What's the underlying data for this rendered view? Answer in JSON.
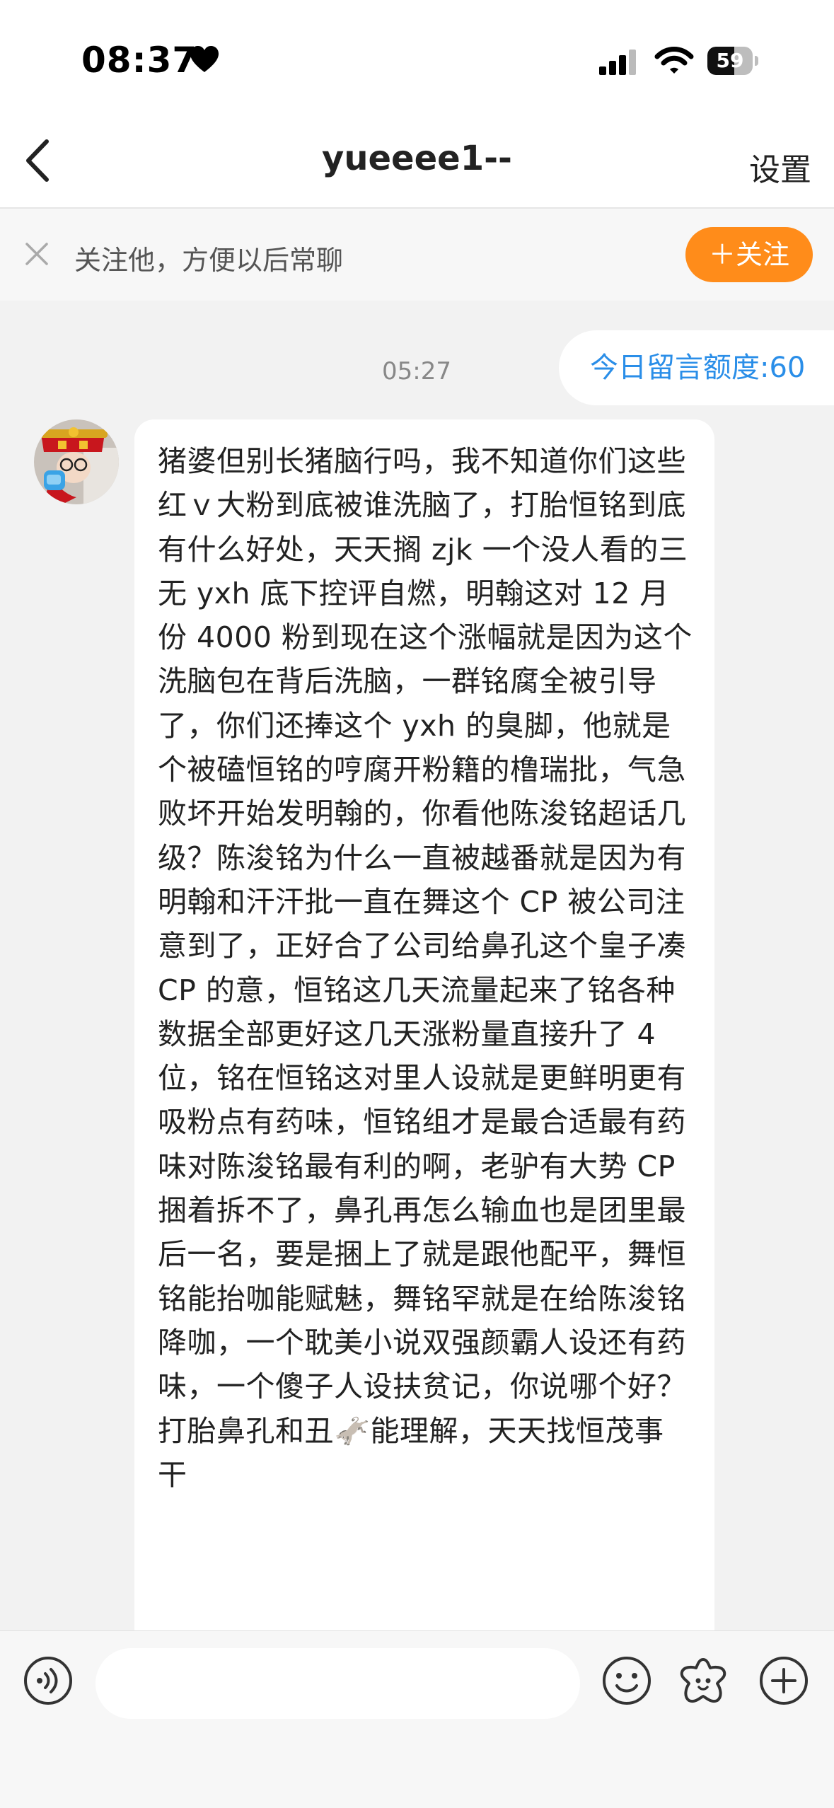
{
  "status_bar": {
    "time": "08:37",
    "battery_level": "59",
    "battery_fraction": 0.59,
    "icons": [
      "heart-icon",
      "cellular-signal-icon",
      "wifi-icon",
      "battery-icon"
    ]
  },
  "nav": {
    "title": "yueeee1--",
    "settings_label": "设置",
    "back_icon": "chevron-left-icon"
  },
  "follow_prompt": {
    "text": "关注他，方便以后常聊",
    "button_label": "＋关注",
    "close_icon": "close-icon",
    "button_color": "#ff8c1a"
  },
  "chat": {
    "timestamp": "05:27",
    "quota_text": "今日留言额度:60",
    "quota_color": "#2a8ee8",
    "message": {
      "text": "猪婆但别长猪脑行吗，我不知道你们这些红ｖ大粉到底被谁洗脑了，打胎恒铭到底有什么好处，天天搁 zjk 一个没人看的三无 yxh 底下控评自燃，明翰这对 12 月份 4000 粉到现在这个涨幅就是因为这个洗脑包在背后洗脑，一群铭腐全被引导了，你们还捧这个 yxh 的臭脚，他就是个被磕恒铭的哼腐开粉籍的橹瑞批，气急败坏开始发明翰的，你看他陈浚铭超话几级？陈浚铭为什么一直被越番就是因为有明翰和汗汗批一直在舞这个 CP 被公司注意到了，正好合了公司给鼻孔这个皇子凑 CP 的意，恒铭这几天流量起来了铭各种数据全部更好这几天涨粉量直接升了 4 位，铭在恒铭这对里人设就是更鲜明更有吸粉点有药味，恒铭组才是最合适最有药味对陈浚铭最有利的啊，老驴有大势 CP 捆着拆不了，鼻孔再怎么输血也是团里最后一名，要是捆上了就是跟他配平，舞恒铭能抬咖能赋魅，舞铭罕就是在给陈浚铭降咖，一个耽美小说双强颜霸人设还有药味，一个傻子人设扶贫记，你说哪个好？打胎鼻孔和丑🫏能理解，天天找恒茂事干"
    }
  },
  "input_bar": {
    "placeholder": "",
    "icons": [
      "voice-icon",
      "emoji-icon",
      "sticker-icon",
      "plus-icon"
    ]
  }
}
